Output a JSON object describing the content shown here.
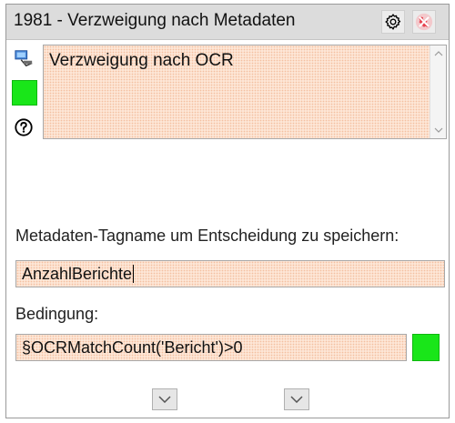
{
  "window": {
    "title": "1981 - Verzweigung nach Metadaten",
    "buttons": {
      "settings_icon": "gear-icon",
      "remove_icon": "remove-icon"
    }
  },
  "sidebar": {
    "computer_icon": "computer-icon",
    "status_color": "#19e619",
    "help_icon": "help-icon"
  },
  "description": {
    "text": "Verzweigung nach OCR"
  },
  "form": {
    "tag_label": "Metadaten-Tagname um Entscheidung zu speichern:",
    "tag_value": "AnzahlBerichte",
    "condition_label": "Bedingung:",
    "condition_value": "§OCRMatchCount('Bericht')>0",
    "condition_color": "#19e619"
  },
  "footer": {
    "left_icon": "chevron-down-icon",
    "right_icon": "chevron-down-icon"
  }
}
